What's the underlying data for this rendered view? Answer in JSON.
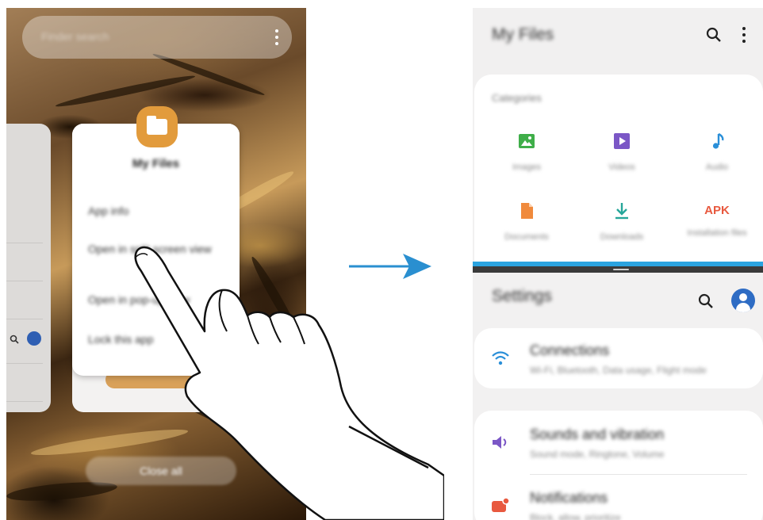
{
  "left_screen": {
    "search_placeholder": "Finder search",
    "prev_card_search_icon": "search-icon",
    "app_card": {
      "icon": "folder-icon",
      "title": "My Files",
      "menu_items": [
        "App info",
        "Open in split screen view",
        "Open in pop-up view",
        "Lock this app"
      ]
    },
    "close_all_label": "Close all"
  },
  "right_screen": {
    "top_app": {
      "title": "My Files",
      "categories_header": "Categories",
      "categories": [
        {
          "label": "Images",
          "icon": "image-icon",
          "color": "#3fae49"
        },
        {
          "label": "Videos",
          "icon": "video-icon",
          "color": "#7b57c6"
        },
        {
          "label": "Audio",
          "icon": "music-note-icon",
          "color": "#2a8fd8"
        },
        {
          "label": "Documents",
          "icon": "document-icon",
          "color": "#f08a3c"
        },
        {
          "label": "Downloads",
          "icon": "download-icon",
          "color": "#26a69a"
        },
        {
          "label": "Installation files",
          "icon": "apk-icon",
          "glyph": "APK",
          "color": "#e8593f"
        }
      ]
    },
    "bottom_app": {
      "title": "Settings",
      "rows": [
        {
          "title": "Connections",
          "subtitle": "Wi-Fi, Bluetooth, Data usage, Flight mode",
          "icon": "wifi-icon"
        },
        {
          "title": "Sounds and vibration",
          "subtitle": "Sound mode, Ringtone, Volume",
          "icon": "speaker-icon"
        },
        {
          "title": "Notifications",
          "subtitle": "Block, allow, prioritize",
          "icon": "notification-icon"
        }
      ]
    }
  },
  "colors": {
    "accent_blue": "#2aa3e0",
    "folder_orange": "#e29b3c",
    "avatar_blue": "#2e6cc4"
  }
}
